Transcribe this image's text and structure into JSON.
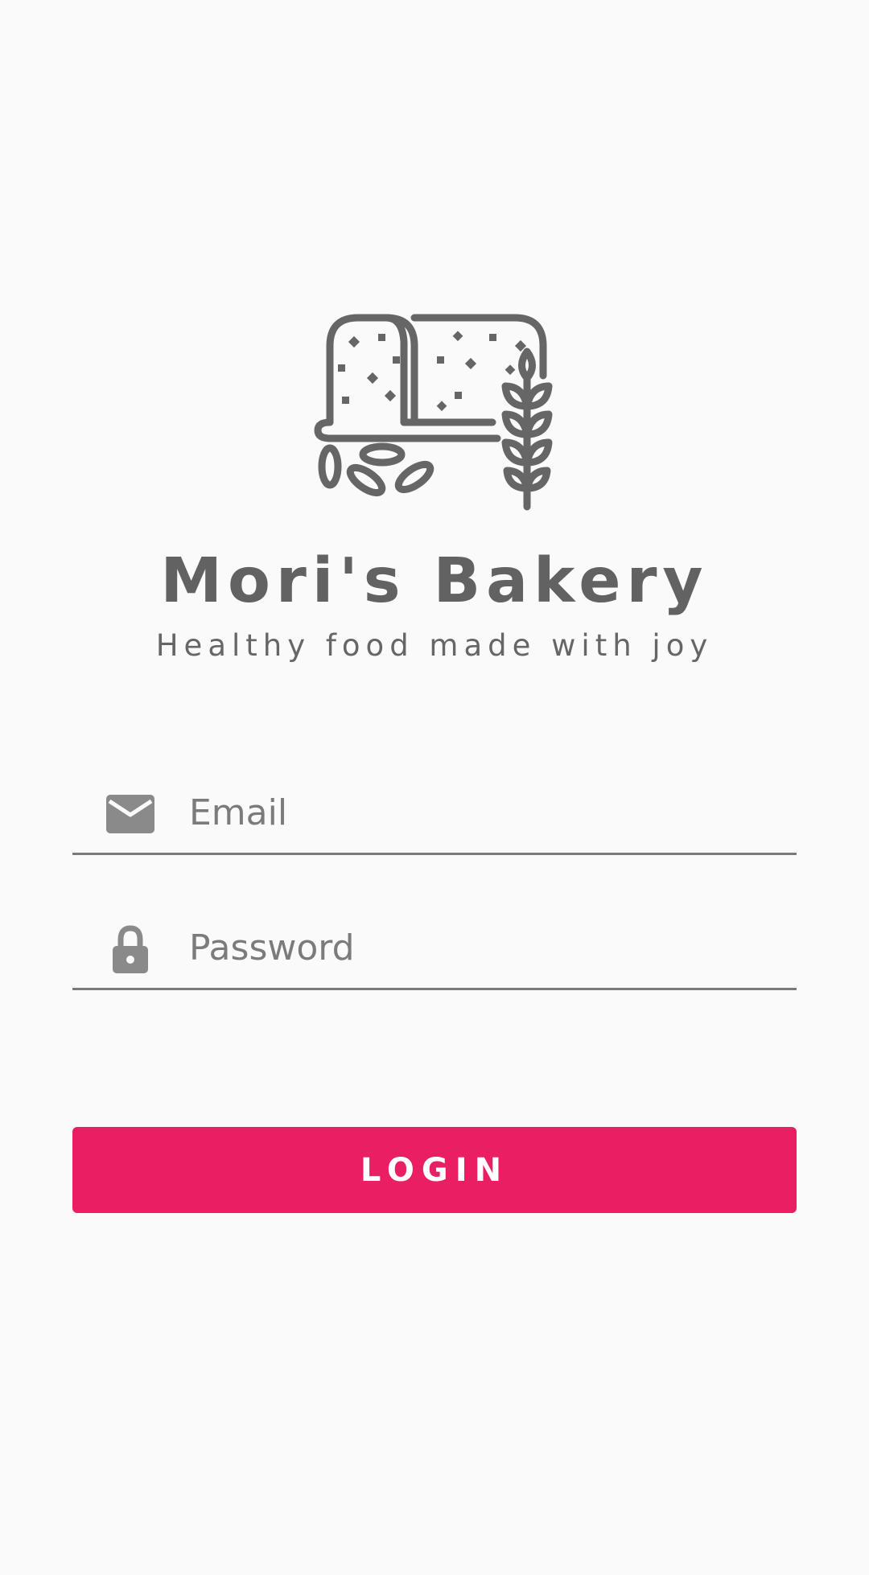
{
  "brand": {
    "logo_icon": "bread-wheat-icon",
    "title": "Mori's Bakery",
    "tagline": "Healthy food made with joy"
  },
  "form": {
    "email": {
      "icon": "envelope-icon",
      "value": "",
      "placeholder": "Email"
    },
    "password": {
      "icon": "lock-icon",
      "value": "",
      "placeholder": "Password"
    },
    "login_label": "LOGIN"
  },
  "colors": {
    "accent": "#e91e63",
    "background": "#fafafa",
    "logo": "#666666",
    "underline": "#7a7a7a"
  }
}
